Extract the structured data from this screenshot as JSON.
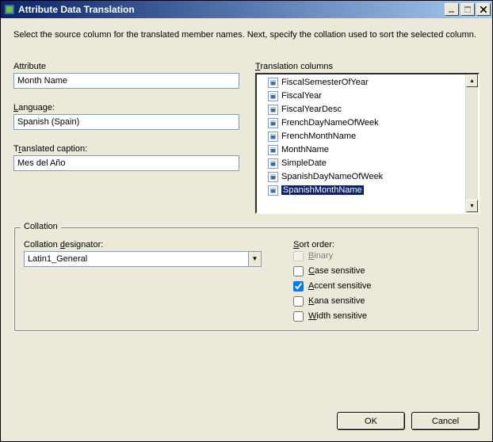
{
  "window": {
    "title": "Attribute Data Translation"
  },
  "instruction": "Select the source column for the translated member names.  Next, specify the collation used to sort the selected column.",
  "labels": {
    "attribute": "Attribute",
    "language": "Language:",
    "translated_caption": "Translated caption:",
    "translation_columns": "Translation columns"
  },
  "fields": {
    "attribute": "Month Name",
    "language": "Spanish (Spain)",
    "translated_caption": "Mes del Año"
  },
  "columns": [
    "FiscalSemesterOfYear",
    "FiscalYear",
    "FiscalYearDesc",
    "FrenchDayNameOfWeek",
    "FrenchMonthName",
    "MonthName",
    "SimpleDate",
    "SpanishDayNameOfWeek",
    "SpanishMonthName"
  ],
  "selected_column_index": 8,
  "collation": {
    "legend": "Collation",
    "designator_label": "Collation designator:",
    "designator_value": "Latin1_General",
    "sort_order_label": "Sort order:",
    "options": {
      "binary": "Binary",
      "case_sensitive": "Case sensitive",
      "accent_sensitive": "Accent sensitive",
      "kana_sensitive": "Kana sensitive",
      "width_sensitive": "Width sensitive"
    },
    "checked": {
      "binary": false,
      "case_sensitive": false,
      "accent_sensitive": true,
      "kana_sensitive": false,
      "width_sensitive": false
    },
    "disabled": {
      "binary": true
    }
  },
  "buttons": {
    "ok": "OK",
    "cancel": "Cancel"
  }
}
